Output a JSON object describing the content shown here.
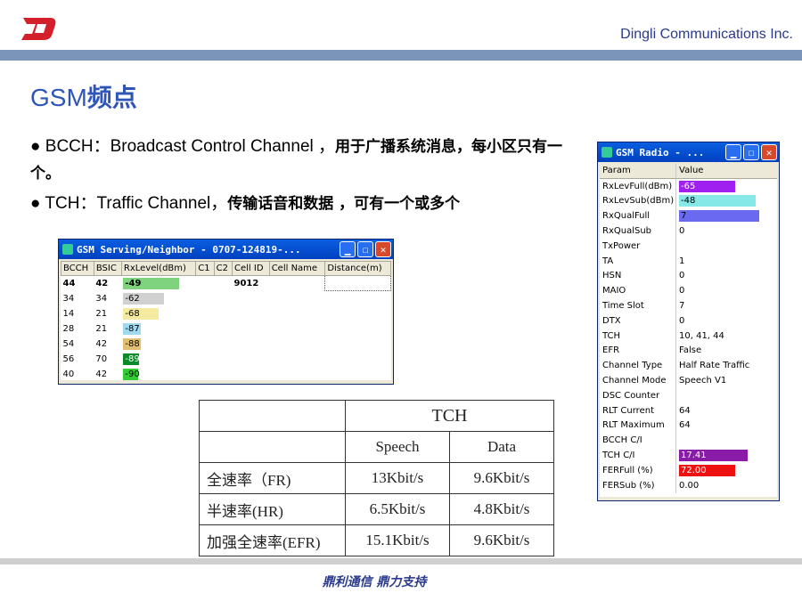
{
  "header": {
    "company": "Dingli Communications Inc.",
    "logo_color": "#d4202a"
  },
  "slide": {
    "title_latin": "GSM",
    "title_cjk": "频点",
    "bullet1_a": "BCCH：Broadcast Control Channel ，",
    "bullet1_b": "用于广播系统消息，每小区只有一个。",
    "bullet2_a": "TCH：Traffic Channel，",
    "bullet2_b": "传输话音和数据 ，可有一个或多个"
  },
  "serving_window": {
    "title": "GSM Serving/Neighbor - 0707-124819-...",
    "columns": [
      "BCCH",
      "BSIC",
      "RxLevel(dBm)",
      "C1",
      "C2",
      "Cell ID",
      "Cell Name",
      "Distance(m)"
    ],
    "rows": [
      {
        "bcch": "44",
        "bsic": "42",
        "rxlevel": "-49",
        "color": "#7fd37f",
        "fill": 0.95,
        "cellid": "9012",
        "bold": true
      },
      {
        "bcch": "34",
        "bsic": "34",
        "rxlevel": "-62",
        "color": "#d0d0d0",
        "fill": 0.7
      },
      {
        "bcch": "14",
        "bsic": "21",
        "rxlevel": "-68",
        "color": "#f5eaa0",
        "fill": 0.6
      },
      {
        "bcch": "28",
        "bsic": "21",
        "rxlevel": "-87",
        "color": "#9fd8ef",
        "fill": 0.3
      },
      {
        "bcch": "54",
        "bsic": "42",
        "rxlevel": "-88",
        "color": "#e0c070",
        "fill": 0.3
      },
      {
        "bcch": "56",
        "bsic": "70",
        "rxlevel": "-89",
        "color": "#0b8a2a",
        "fill": 0.28
      },
      {
        "bcch": "40",
        "bsic": "42",
        "rxlevel": "-90",
        "color": "#33cc33",
        "fill": 0.26
      }
    ]
  },
  "radio_window": {
    "title": "GSM Radio - ...",
    "col_param": "Param",
    "col_value": "Value",
    "rows": [
      {
        "p": "RxLevFull(dBm)",
        "v": "-65",
        "bar": "#a020f0",
        "fill": 0.7
      },
      {
        "p": "RxLevSub(dBm)",
        "v": "-48",
        "bar": "#87e8e8",
        "fill": 0.95,
        "dark": true
      },
      {
        "p": "RxQualFull",
        "v": "7",
        "bar": "#6a6af0",
        "fill": 1.0,
        "dark": true
      },
      {
        "p": "RxQualSub",
        "v": "0"
      },
      {
        "p": "TxPower",
        "v": ""
      },
      {
        "p": "TA",
        "v": "1"
      },
      {
        "p": "HSN",
        "v": "0"
      },
      {
        "p": "MAIO",
        "v": "0"
      },
      {
        "p": "Time Slot",
        "v": "7"
      },
      {
        "p": "DTX",
        "v": "0"
      },
      {
        "p": "TCH",
        "v": "10, 41, 44"
      },
      {
        "p": "EFR",
        "v": "False"
      },
      {
        "p": "Channel Type",
        "v": "Half Rate Traffic"
      },
      {
        "p": "Channel Mode",
        "v": "Speech V1"
      },
      {
        "p": "DSC Counter",
        "v": ""
      },
      {
        "p": "RLT Current",
        "v": "64"
      },
      {
        "p": "RLT Maximum",
        "v": "64"
      },
      {
        "p": "BCCH C/I",
        "v": ""
      },
      {
        "p": "TCH C/I",
        "v": "17.41",
        "bar": "#8a1aa8",
        "fill": 0.85
      },
      {
        "p": "FERFull (%)",
        "v": "72.00",
        "bar": "#ee1111",
        "fill": 0.7
      },
      {
        "p": "FERSub (%)",
        "v": "0.00"
      }
    ]
  },
  "tch_table": {
    "header": "TCH",
    "col1": "Speech",
    "col2": "Data",
    "rows": [
      {
        "label": "全速率（FR)",
        "speech": "13Kbit/s",
        "data": "9.6Kbit/s"
      },
      {
        "label": "半速率(HR)",
        "speech": "6.5Kbit/s",
        "data": "4.8Kbit/s"
      },
      {
        "label": "加强全速率(EFR)",
        "speech": "15.1Kbit/s",
        "data": "9.6Kbit/s"
      }
    ]
  },
  "footer": {
    "text": "鼎利通信 鼎力支持"
  }
}
